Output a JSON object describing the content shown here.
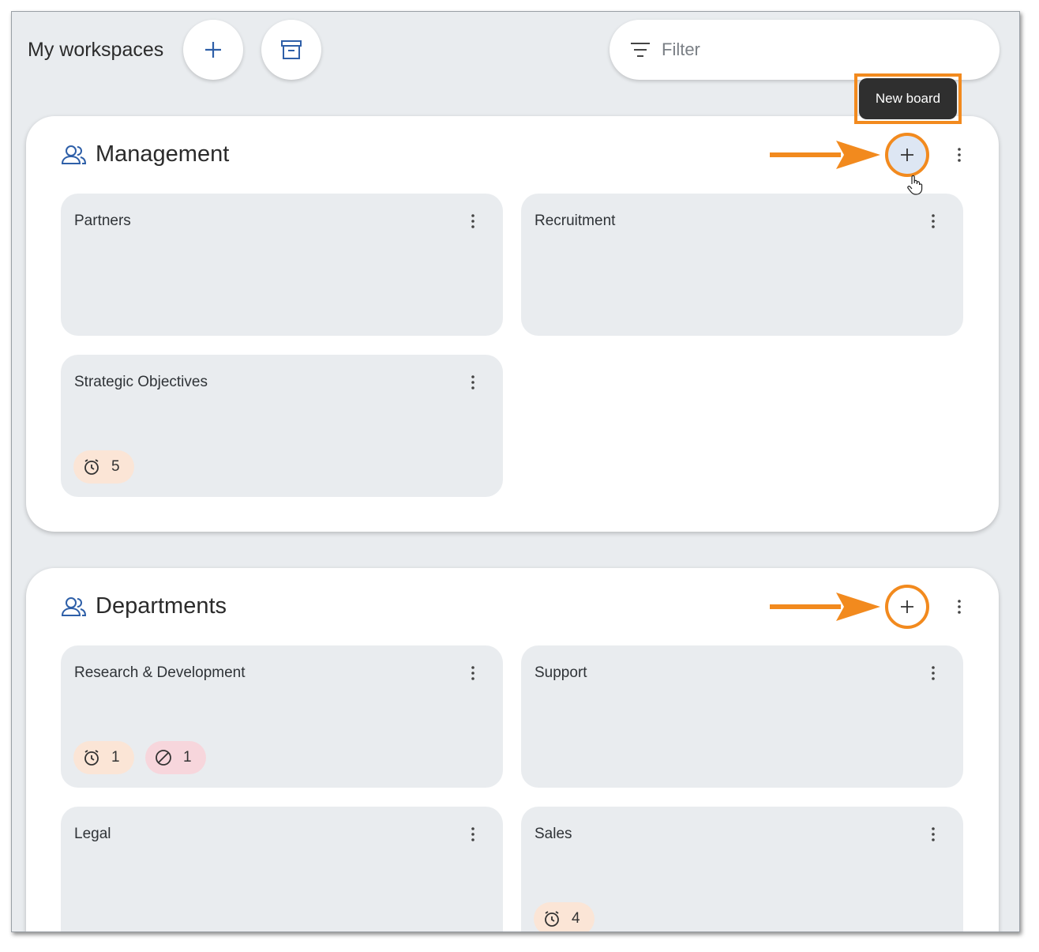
{
  "header": {
    "title": "My workspaces",
    "add_icon": "plus-icon",
    "archive_icon": "archive-icon",
    "filter_placeholder": "Filter",
    "filter_icon": "filter-icon"
  },
  "tooltip": {
    "text": "New board"
  },
  "colors": {
    "accent": "#2e5fa8",
    "highlight": "#f28a1e",
    "card_bg": "#e9ecef",
    "badge_warn_bg": "#fbe5d6",
    "badge_block_bg": "#f7d6dc"
  },
  "workspaces": [
    {
      "name": "Management",
      "icon": "people-icon",
      "boards": [
        {
          "name": "Partners",
          "badges": []
        },
        {
          "name": "Recruitment",
          "badges": []
        },
        {
          "name": "Strategic Objectives",
          "badges": [
            {
              "icon": "alarm-clock-icon",
              "count": "5"
            }
          ]
        }
      ]
    },
    {
      "name": "Departments",
      "icon": "people-icon",
      "boards": [
        {
          "name": "Research & Development",
          "badges": [
            {
              "icon": "alarm-clock-icon",
              "count": "1"
            },
            {
              "icon": "blocked-icon",
              "count": "1"
            }
          ]
        },
        {
          "name": "Support",
          "badges": []
        },
        {
          "name": "Legal",
          "badges": []
        },
        {
          "name": "Sales",
          "badges": [
            {
              "icon": "alarm-clock-icon",
              "count": "4"
            }
          ]
        }
      ]
    }
  ]
}
